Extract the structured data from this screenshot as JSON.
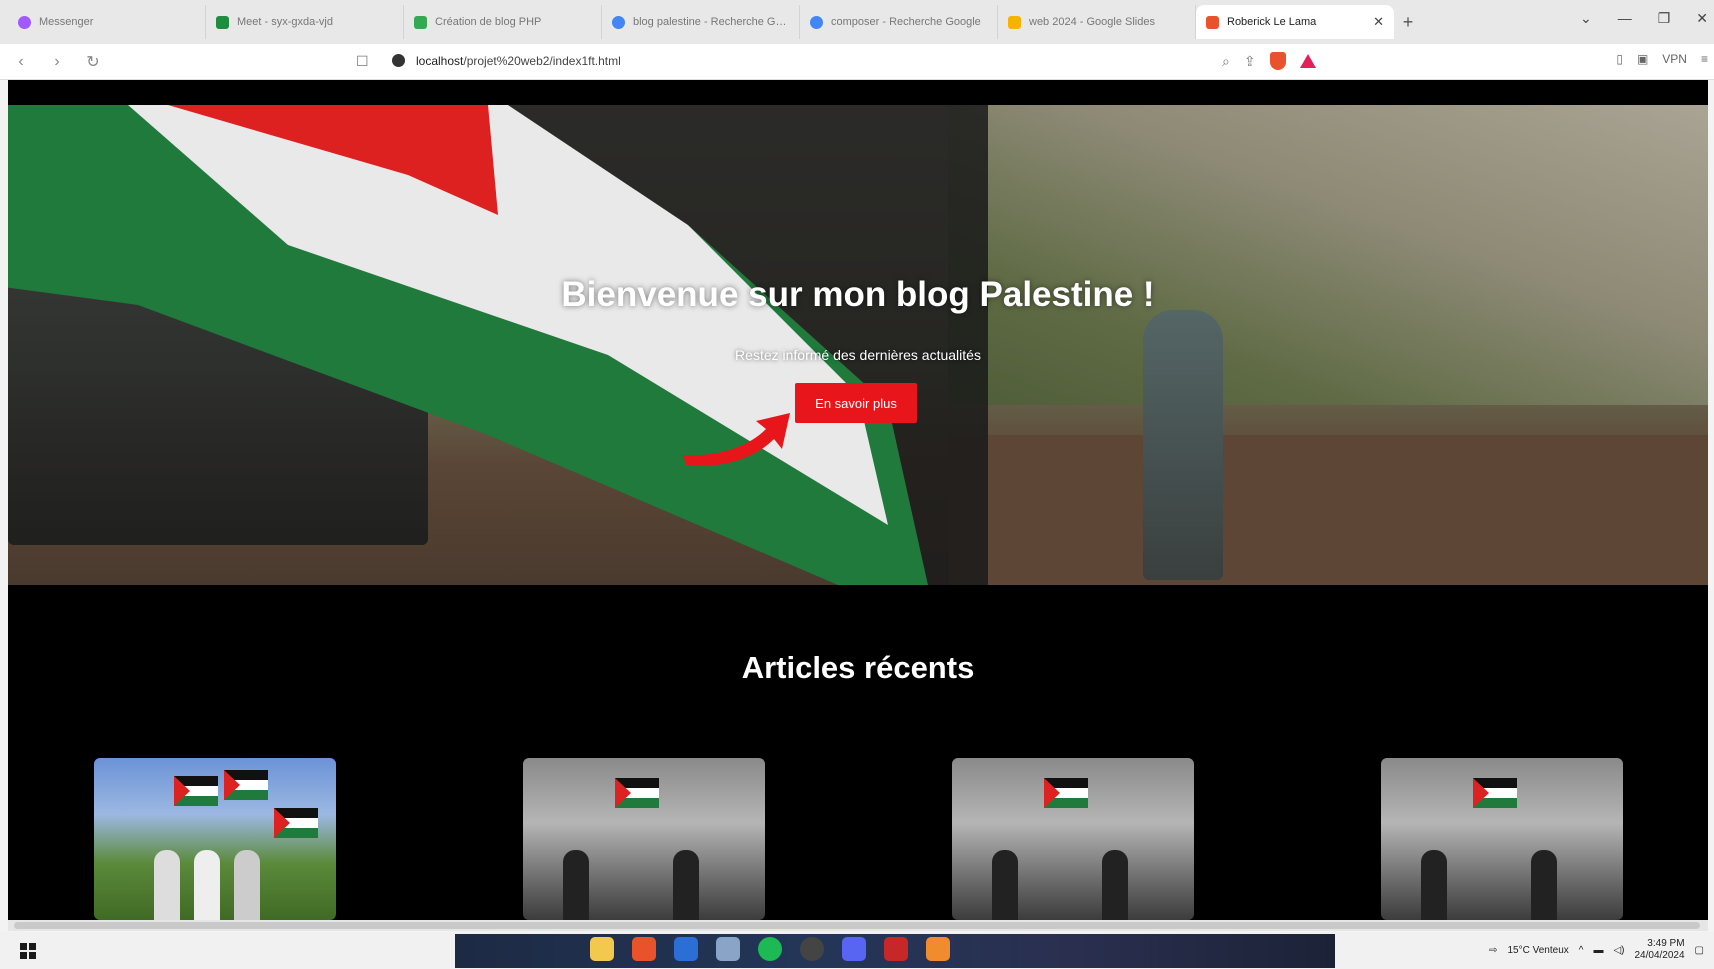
{
  "browser": {
    "tabs": [
      {
        "title": "Messenger",
        "color": "#a259ff",
        "active": false
      },
      {
        "title": "Meet - syx-gxda-vjd",
        "color": "#1e8e3e",
        "active": false
      },
      {
        "title": "Création de blog PHP",
        "color": "#34a853",
        "active": false
      },
      {
        "title": "blog palestine - Recherche Google",
        "color": "#4285f4",
        "active": false
      },
      {
        "title": "composer - Recherche Google",
        "color": "#4285f4",
        "active": false
      },
      {
        "title": "web 2024 - Google Slides",
        "color": "#f4b400",
        "active": false
      },
      {
        "title": "Roberick Le Lama",
        "color": "#e8532b",
        "active": true
      }
    ],
    "url_host": "localhost",
    "url_path": "/projet%20web2/index1ft.html",
    "vpn_label": "VPN"
  },
  "page": {
    "hero": {
      "title": "Bienvenue sur mon blog Palestine !",
      "subtitle": "Restez informé des dernières actualités",
      "button_label": "En savoir plus",
      "accent_color": "#e8151b"
    },
    "recent": {
      "title": "Articles récents",
      "cards": [
        {
          "image": "flags-group-color"
        },
        {
          "image": "flag-bw"
        },
        {
          "image": "flag-bw"
        },
        {
          "image": "flag-bw"
        }
      ]
    }
  },
  "taskbar": {
    "weather": "15°C Venteux",
    "time": "3:49 PM",
    "date": "24/04/2024"
  }
}
